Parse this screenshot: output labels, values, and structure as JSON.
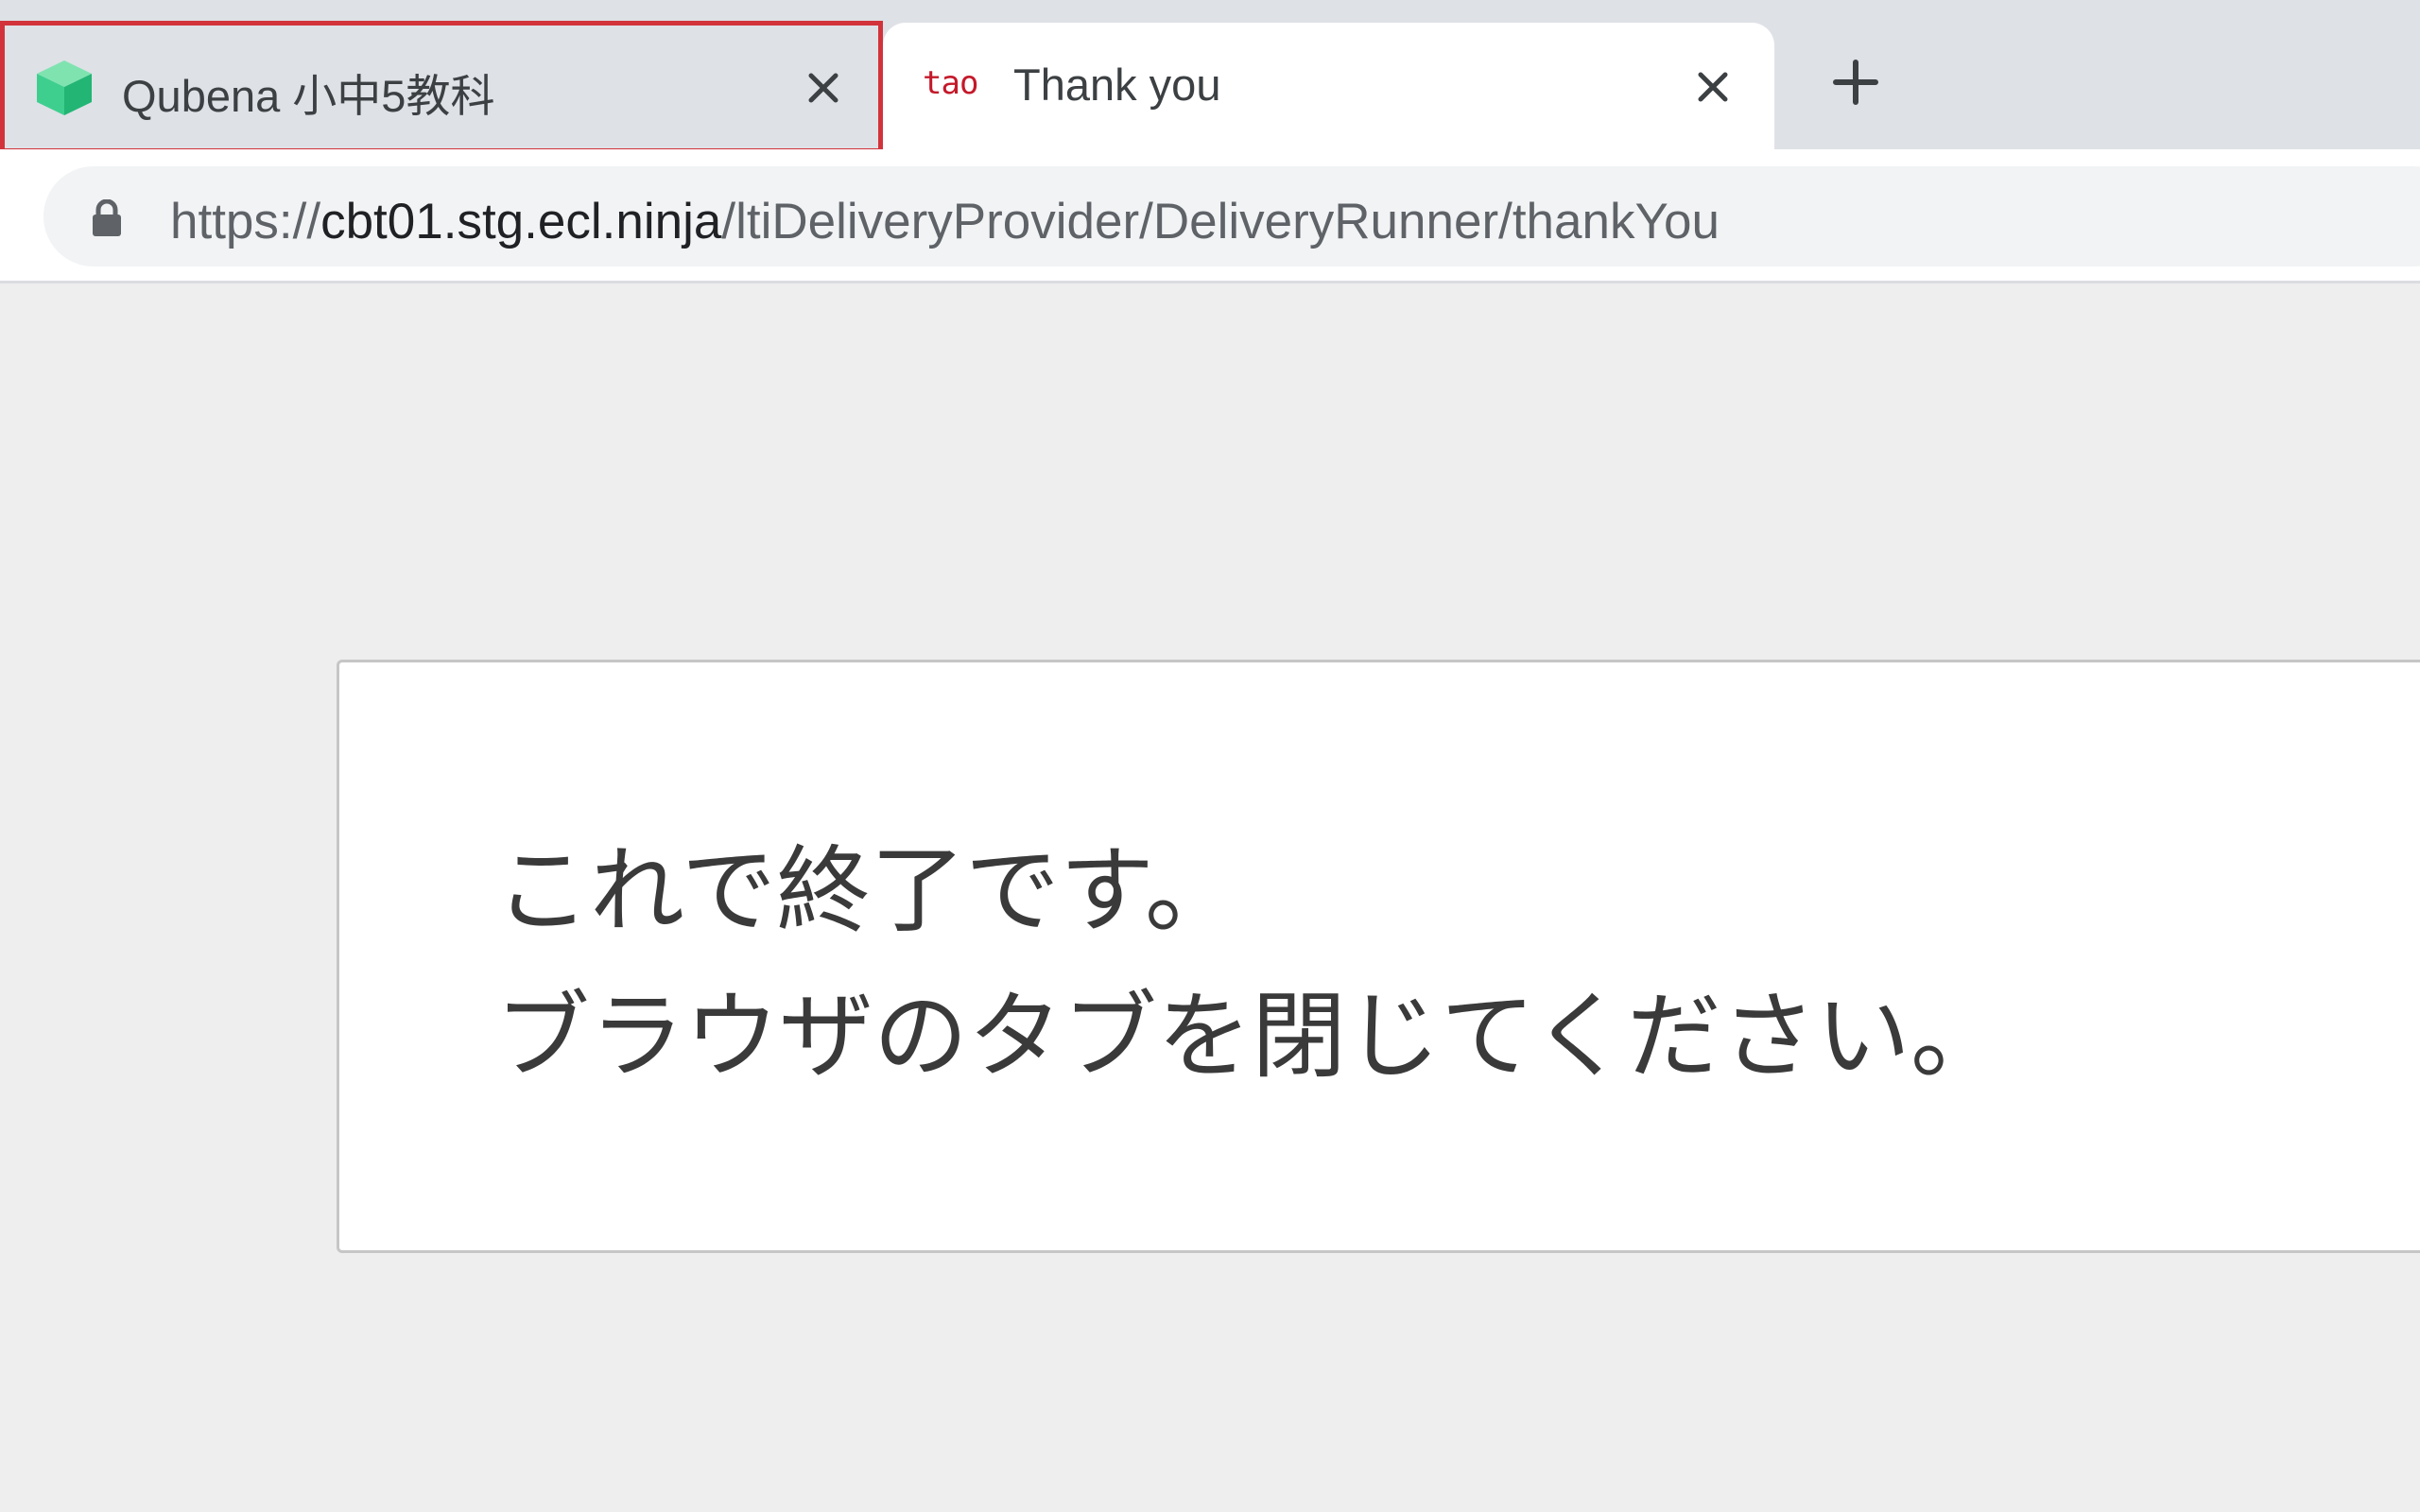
{
  "browser": {
    "tabs": [
      {
        "title": "Qubena 小中5教科",
        "favicon": "qubena-cube-icon",
        "active": false,
        "highlighted": true,
        "highlight_color": "#d2333b"
      },
      {
        "title": "Thank you",
        "favicon_text": "tao",
        "active": true
      }
    ],
    "address_bar": {
      "scheme": "https://",
      "host": "cbt01.stg.ecl.ninja",
      "path": "/ltiDeliveryProvider/DeliveryRunner/thankYou"
    }
  },
  "page": {
    "message_line1": "これで終了です。",
    "message_line2": "ブラウザのタブを閉じてください。"
  },
  "colors": {
    "tabbar_bg": "#dee1e6",
    "favicon_green": "#3ecf8e",
    "tao_red": "#c4192a",
    "page_bg": "#eeeeef"
  }
}
